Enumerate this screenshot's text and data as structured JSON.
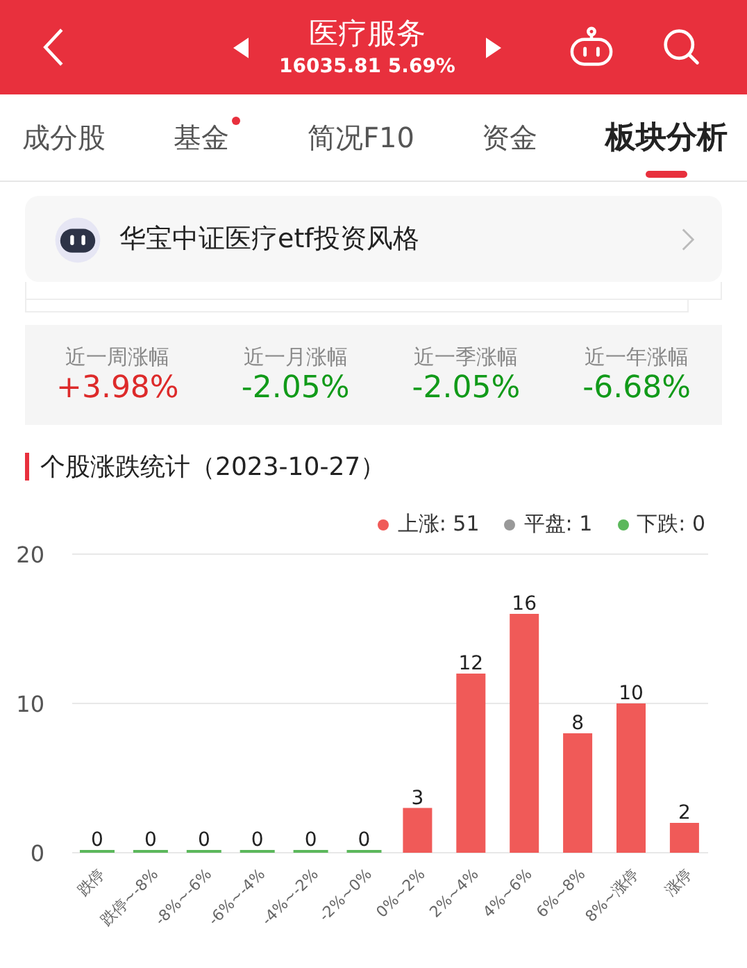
{
  "header": {
    "title": "医疗服务",
    "price": "16035.81",
    "change": "5.69%"
  },
  "tabs": [
    {
      "label": "成分股",
      "selected": false,
      "dot": false
    },
    {
      "label": "基金",
      "selected": false,
      "dot": true
    },
    {
      "label": "简况F10",
      "selected": false,
      "dot": false
    },
    {
      "label": "资金",
      "selected": false,
      "dot": false
    },
    {
      "label": "板块分析",
      "selected": true,
      "dot": false
    }
  ],
  "card": {
    "text": "华宝中证医疗etf投资风格"
  },
  "stats": [
    {
      "label": "近一周涨幅",
      "value": "+3.98%",
      "color": "#dd2a2a"
    },
    {
      "label": "近一月涨幅",
      "value": "-2.05%",
      "color": "#119a19"
    },
    {
      "label": "近一季涨幅",
      "value": "-2.05%",
      "color": "#119a19"
    },
    {
      "label": "近一年涨幅",
      "value": "-6.68%",
      "color": "#119a19"
    }
  ],
  "section": {
    "title": "个股涨跌统计（2023-10-27）"
  },
  "legend": [
    {
      "label": "上涨: 51",
      "color": "#f05a58"
    },
    {
      "label": "平盘: 1",
      "color": "#999999"
    },
    {
      "label": "下跌: 0",
      "color": "#5cb85c"
    }
  ],
  "chart_data": {
    "type": "bar",
    "stacked": true,
    "data_labels": true,
    "ylim": [
      0,
      20
    ],
    "yticks": [
      0,
      10,
      20
    ],
    "categories": [
      "跌停",
      "跌停~-8%",
      "-8%~-6%",
      "-6%~-4%",
      "-4%~-2%",
      "-2%~0%",
      "0%~2%",
      "2%~4%",
      "4%~6%",
      "6%~8%",
      "8%~涨停",
      "涨停"
    ],
    "series": [
      {
        "color": "#5cb85c",
        "values": [
          0,
          0,
          0,
          0,
          0,
          0,
          null,
          null,
          null,
          null,
          null,
          null
        ]
      },
      {
        "color": "#f05a58",
        "values": [
          null,
          null,
          null,
          null,
          null,
          null,
          3,
          12,
          16,
          8,
          10,
          2
        ]
      }
    ]
  }
}
